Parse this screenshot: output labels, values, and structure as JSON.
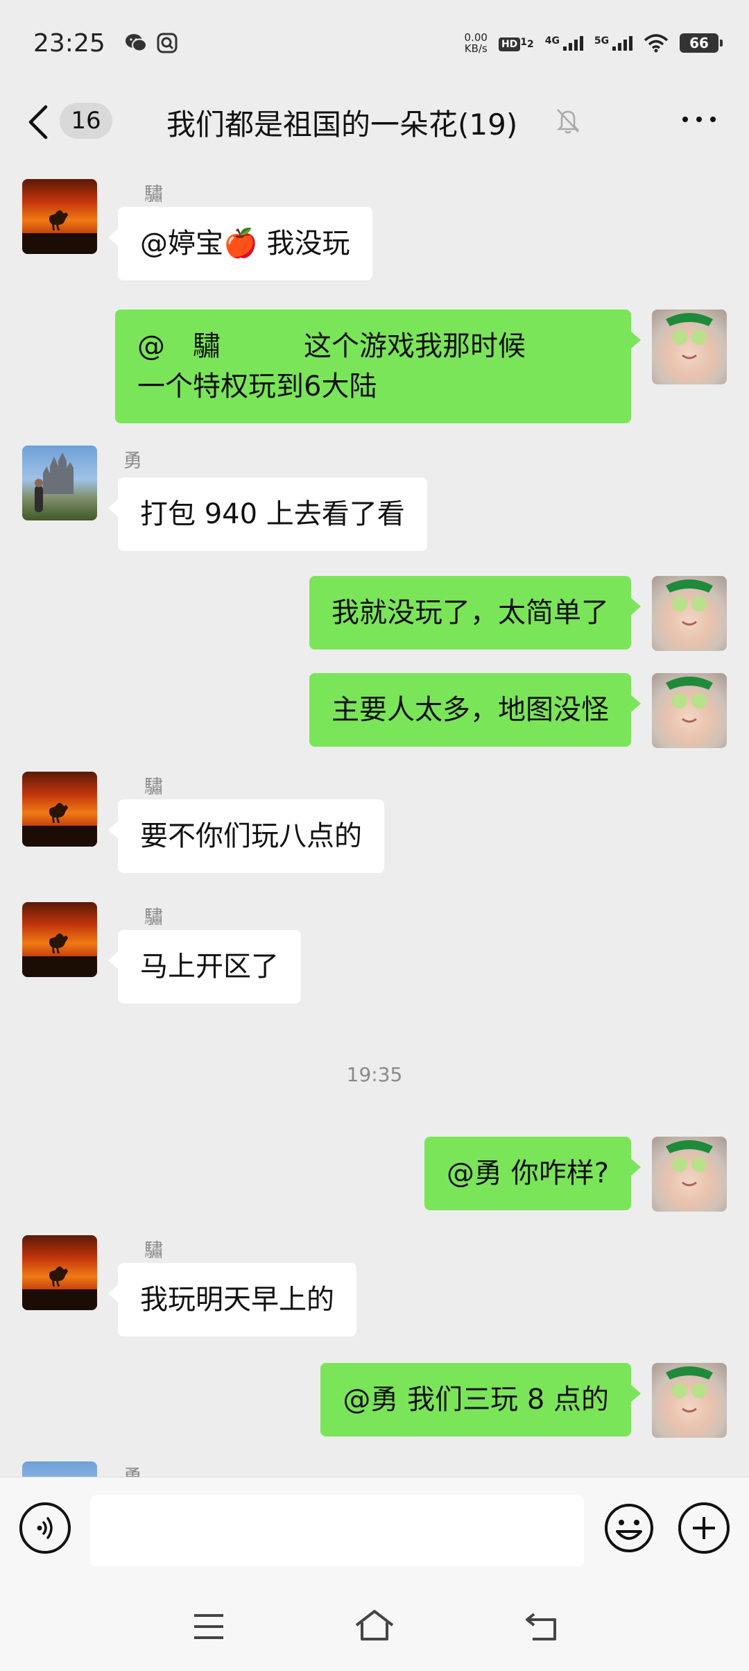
{
  "status_bar": {
    "time": "23:25",
    "net_speed_value": "0.00",
    "net_speed_unit": "KB/s",
    "hd_label": "HD",
    "hd_sim": "1",
    "hd_sim2": "2",
    "net_4g": "4G",
    "net_5g": "5G",
    "battery": "66"
  },
  "header": {
    "unread_count": "16",
    "title": "我们都是祖国的一朵花(19)"
  },
  "messages": [
    {
      "direction": "in",
      "sender": "驌",
      "text": "@婷宝🍎 我没玩"
    },
    {
      "direction": "out",
      "line1": "@　驌　　　这个游戏我那时候",
      "line2": "一个特权玩到6大陆"
    },
    {
      "direction": "in",
      "sender": "勇",
      "text": "打包 940  上去看了看"
    },
    {
      "direction": "out",
      "text": "我就没玩了，太简单了"
    },
    {
      "direction": "out",
      "text": "主要人太多，地图没怪"
    },
    {
      "direction": "in",
      "sender": "驌",
      "text": "要不你们玩八点的"
    },
    {
      "direction": "in",
      "sender": "驌",
      "text": "马上开区了"
    },
    {
      "direction": "out",
      "text": "@勇  你咋样?"
    },
    {
      "direction": "in",
      "sender": "驌",
      "text": "我玩明天早上的"
    },
    {
      "direction": "out",
      "text": "@勇  我们三玩 8 点的"
    },
    {
      "direction": "in",
      "sender": "勇",
      "text": ""
    }
  ],
  "timestamp": "19:35",
  "composer": {
    "placeholder": ""
  },
  "colors": {
    "background": "#ededed",
    "outgoing_bubble": "#7be55a",
    "incoming_bubble": "#ffffff"
  },
  "icons": {
    "back": "chevron-left-icon",
    "mute": "bell-off-icon",
    "more": "more-dots-icon",
    "voice": "voice-icon",
    "emoji": "emoji-icon",
    "plus": "plus-icon",
    "nav_menu": "menu-icon",
    "nav_home": "home-icon",
    "nav_back": "back-arrow-icon"
  }
}
